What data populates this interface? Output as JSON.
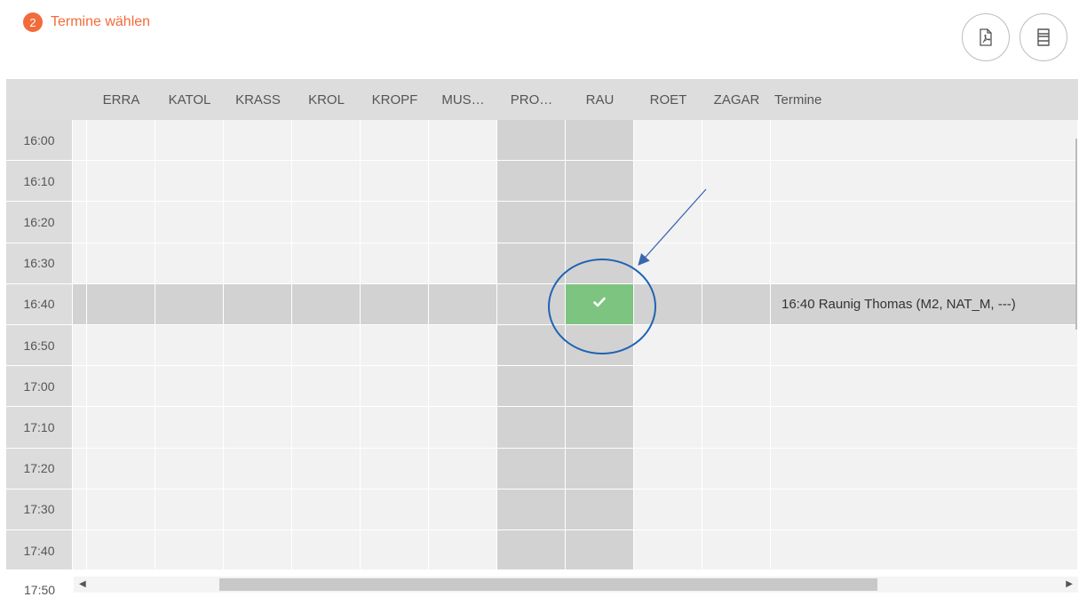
{
  "step": {
    "number": "2",
    "title": "Termine wählen"
  },
  "toolbar": {
    "pdf_icon": "pdf-icon",
    "layout_icon": "layout-icon"
  },
  "schedule": {
    "columns": [
      "ERRA",
      "KATOL",
      "KRASS",
      "KROL",
      "KROPF",
      "MUS…",
      "PRO…",
      "RAU",
      "ROET",
      "ZAGAR"
    ],
    "termine_header": "Termine",
    "times": [
      "16:00",
      "16:10",
      "16:20",
      "16:30",
      "16:40",
      "16:50",
      "17:00",
      "17:10",
      "17:20",
      "17:30",
      "17:40"
    ],
    "partial_time": "17:50",
    "busy_columns": [
      "PRO…",
      "RAU"
    ],
    "booked_slot": {
      "time": "16:40",
      "column": "RAU",
      "icon": "check-icon"
    },
    "appointment": "16:40 Raunig Thomas (M2, NAT_M, ---)"
  },
  "colors": {
    "accent": "#f26b3a",
    "booked": "#7cc47f",
    "busy": "#d2d2d2",
    "annotation": "#1f63b3"
  }
}
